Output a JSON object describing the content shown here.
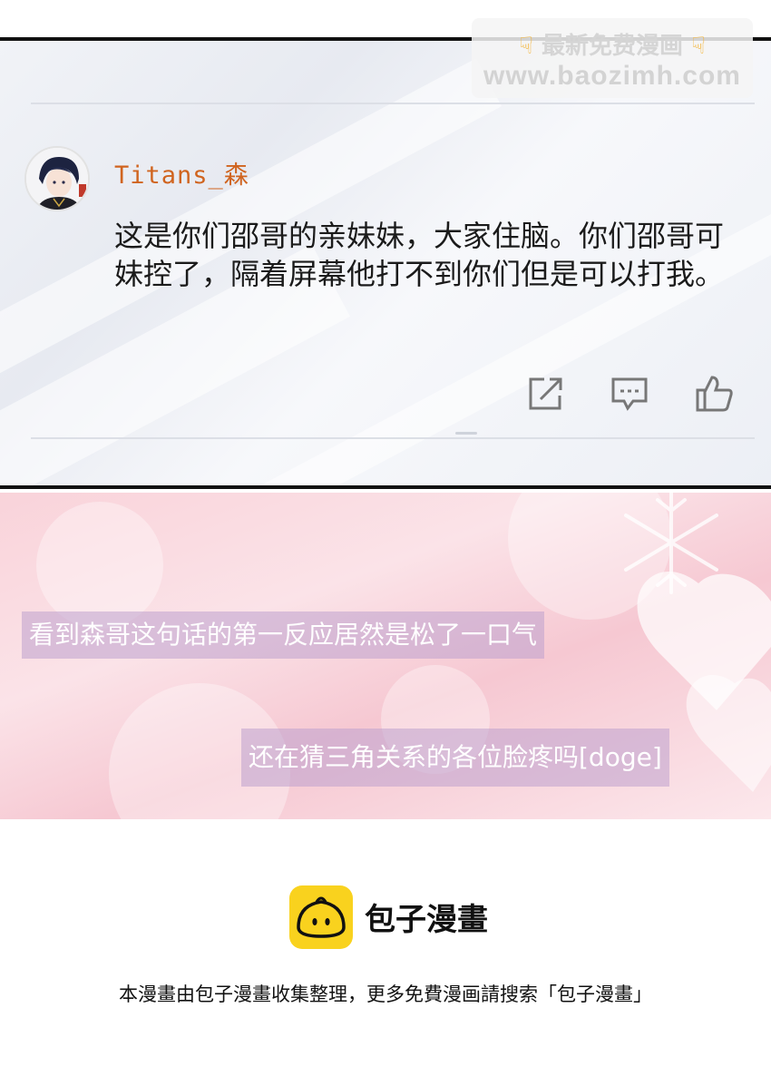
{
  "watermark": {
    "line1": "最新免费漫画",
    "hand_icon": "pointing-down-hand-icon",
    "line2": "www.baozimh.com"
  },
  "comment": {
    "username": "Titans_森",
    "text": "这是你们邵哥的亲妹妹，大家住脑。你们邵哥可妹控了，隔着屏幕他打不到你们但是可以打我。",
    "actions": [
      "share-icon",
      "reply-icon",
      "like-icon"
    ]
  },
  "captions": {
    "first": "看到森哥这句话的第一反应居然是松了一口气",
    "second": "还在猜三角关系的各位脸疼吗[doge]"
  },
  "footer": {
    "brand": "包子漫畫",
    "note": "本漫畫由包子漫畫收集整理，更多免費漫画請搜索「包子漫畫」",
    "logo_color": "#f9d21e"
  },
  "colors": {
    "username": "#d0641f",
    "panel_border": "#111111",
    "caption_bg": "#bea0cd"
  }
}
